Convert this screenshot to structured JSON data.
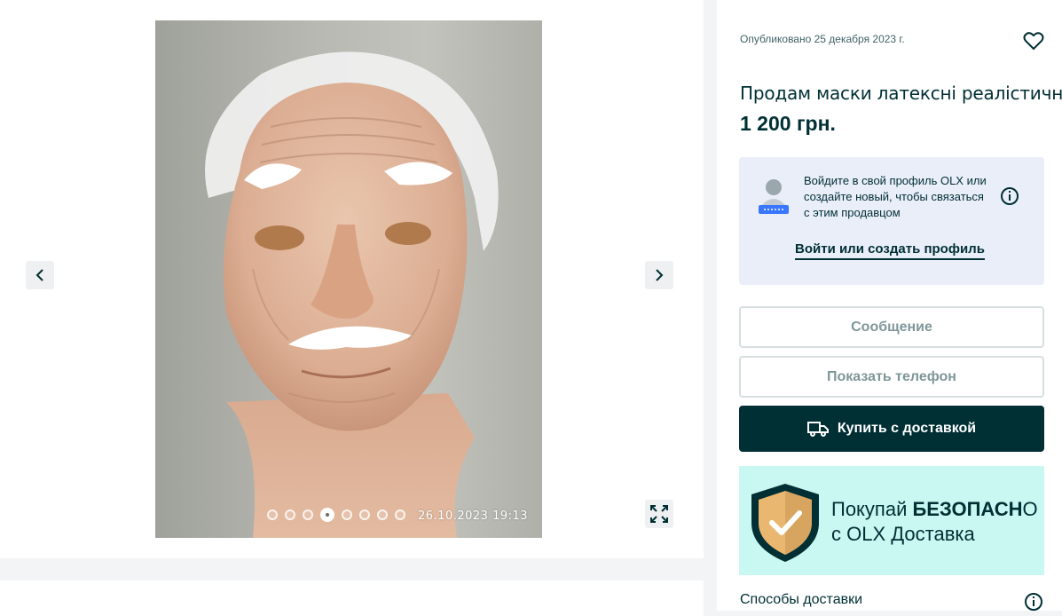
{
  "gallery": {
    "photo_alt": "latex mask photo",
    "photo_timestamp": "26.10.2023  19:13",
    "dots_total": 8,
    "dot_active_index": 3,
    "prev_icon": "chevron-left-icon",
    "next_icon": "chevron-right-icon",
    "fullscreen_icon": "expand-icon"
  },
  "ad": {
    "published": "Опубликовано 25 декабря 2023 г.",
    "title": "Продам маски латексні реалістичні",
    "price": "1 200 грн."
  },
  "login_prompt": {
    "text": "Войдите в свой профиль OLX или создайте новый, чтобы связаться с этим продавцом",
    "link_label": "Войти или создать профиль"
  },
  "actions": {
    "message_label": "Сообщение",
    "phone_label": "Показать телефон",
    "buy_label": "Купить с доставкой"
  },
  "promo": {
    "line1_prefix": "Покупай ",
    "line1_bold": "БЕЗОПАСН",
    "line1_suffix": "О",
    "line2": "с OLX Доставка"
  },
  "delivery": {
    "title": "Способы доставки"
  },
  "colors": {
    "brand_dark": "#002f34",
    "login_bg": "#eaeef9",
    "promo_bg": "#c8f8f1",
    "shield_fill": "#e9b770"
  }
}
